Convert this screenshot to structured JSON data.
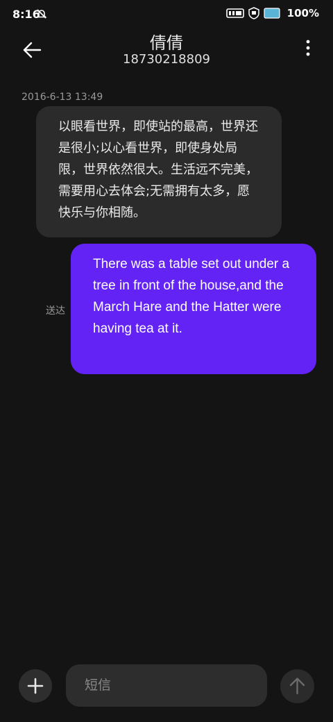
{
  "status_bar": {
    "time": "8:16",
    "battery_percent": "100%"
  },
  "header": {
    "contact_name": "倩倩",
    "phone_number": "18730218809"
  },
  "conversation": {
    "timestamp": "2016-6-13 13:49",
    "messages": [
      {
        "direction": "incoming",
        "text": "以眼看世界，即使站的最高，世界还是很小;以心看世界，即使身处局限，世界依然很大。生活远不完美，需要用心去体会;无需拥有太多，愿快乐与你相随。"
      },
      {
        "direction": "outgoing",
        "text": "There was a table set out under a tree in front of the house,and the March Hare and the Hatter were having tea at it.",
        "status": "送达"
      }
    ]
  },
  "composer": {
    "placeholder": "短信"
  },
  "colors": {
    "background": "#141414",
    "incoming_bubble": "#2b2b2b",
    "outgoing_bubble": "#6323f5"
  },
  "icons": {
    "back": "back-arrow-icon",
    "menu": "more-vertical-icon",
    "add": "plus-icon",
    "send": "send-arrow-up-icon",
    "mute": "bell-off-icon"
  }
}
